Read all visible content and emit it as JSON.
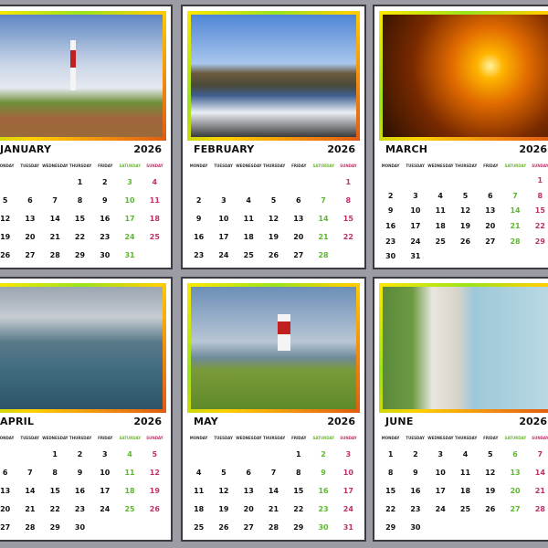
{
  "weekdays": [
    "MONDAY",
    "TUESDAY",
    "WEDNESDAY",
    "THURSDAY",
    "FRIDAY",
    "SATURDAY",
    "SUNDAY"
  ],
  "colors": {
    "saturday": "#5cb82e",
    "sunday": "#c0306a"
  },
  "months": [
    {
      "name": "JANUARY",
      "year": "2026",
      "weeks": [
        [
          null,
          null,
          null,
          1,
          2,
          3,
          4
        ],
        [
          5,
          6,
          7,
          8,
          9,
          10,
          11
        ],
        [
          12,
          13,
          14,
          15,
          16,
          17,
          18
        ],
        [
          19,
          20,
          21,
          22,
          23,
          24,
          25
        ],
        [
          26,
          27,
          28,
          29,
          30,
          31,
          null
        ]
      ]
    },
    {
      "name": "FEBRUARY",
      "year": "2026",
      "weeks": [
        [
          null,
          null,
          null,
          null,
          null,
          null,
          1
        ],
        [
          2,
          3,
          4,
          5,
          6,
          7,
          8
        ],
        [
          9,
          10,
          11,
          12,
          13,
          14,
          15
        ],
        [
          16,
          17,
          18,
          19,
          20,
          21,
          22
        ],
        [
          23,
          24,
          25,
          26,
          27,
          28,
          null
        ]
      ]
    },
    {
      "name": "MARCH",
      "year": "2026",
      "weeks": [
        [
          null,
          null,
          null,
          null,
          null,
          null,
          1
        ],
        [
          2,
          3,
          4,
          5,
          6,
          7,
          8
        ],
        [
          9,
          10,
          11,
          12,
          13,
          14,
          15
        ],
        [
          16,
          17,
          18,
          19,
          20,
          21,
          22
        ],
        [
          23,
          24,
          25,
          26,
          27,
          28,
          29
        ],
        [
          30,
          31,
          null,
          null,
          null,
          null,
          null
        ]
      ]
    },
    {
      "name": "APRIL",
      "year": "2026",
      "weeks": [
        [
          null,
          null,
          1,
          2,
          3,
          4,
          5
        ],
        [
          6,
          7,
          8,
          9,
          10,
          11,
          12
        ],
        [
          13,
          14,
          15,
          16,
          17,
          18,
          19
        ],
        [
          20,
          21,
          22,
          23,
          24,
          25,
          26
        ],
        [
          27,
          28,
          29,
          30,
          null,
          null,
          null
        ]
      ]
    },
    {
      "name": "MAY",
      "year": "2026",
      "weeks": [
        [
          null,
          null,
          null,
          null,
          1,
          2,
          3
        ],
        [
          4,
          5,
          6,
          7,
          8,
          9,
          10
        ],
        [
          11,
          12,
          13,
          14,
          15,
          16,
          17
        ],
        [
          18,
          19,
          20,
          21,
          22,
          23,
          24
        ],
        [
          25,
          26,
          27,
          28,
          29,
          30,
          31
        ]
      ]
    },
    {
      "name": "JUNE",
      "year": "2026",
      "weeks": [
        [
          1,
          2,
          3,
          4,
          5,
          6,
          7
        ],
        [
          8,
          9,
          10,
          11,
          12,
          13,
          14
        ],
        [
          15,
          16,
          17,
          18,
          19,
          20,
          21
        ],
        [
          22,
          23,
          24,
          25,
          26,
          27,
          28
        ],
        [
          29,
          30,
          null,
          null,
          null,
          null,
          null
        ]
      ]
    }
  ]
}
